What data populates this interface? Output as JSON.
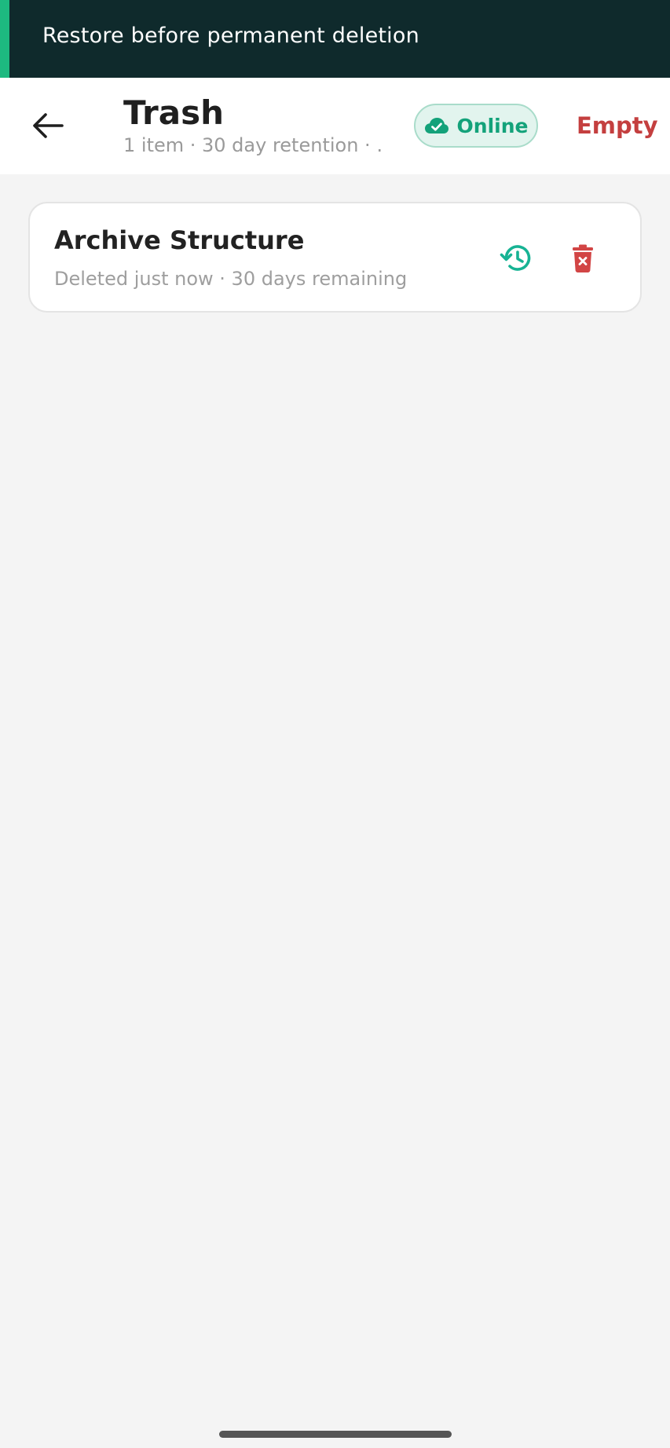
{
  "banner": {
    "message": "Restore before permanent deletion",
    "accent_color": "#1db980"
  },
  "header": {
    "back_icon": "arrow-left-icon",
    "title": "Trash",
    "subtitle": "1 item · 30 day retention · …",
    "status": {
      "icon": "cloud-check-icon",
      "label": "Online",
      "color": "#13a27a"
    },
    "empty_label": "Empty",
    "empty_color": "#c43f3f"
  },
  "items": [
    {
      "title": "Archive Structure",
      "meta": "Deleted just now · 30 days remaining",
      "restore_icon": "restore-history-icon",
      "delete_icon": "delete-forever-icon"
    }
  ]
}
